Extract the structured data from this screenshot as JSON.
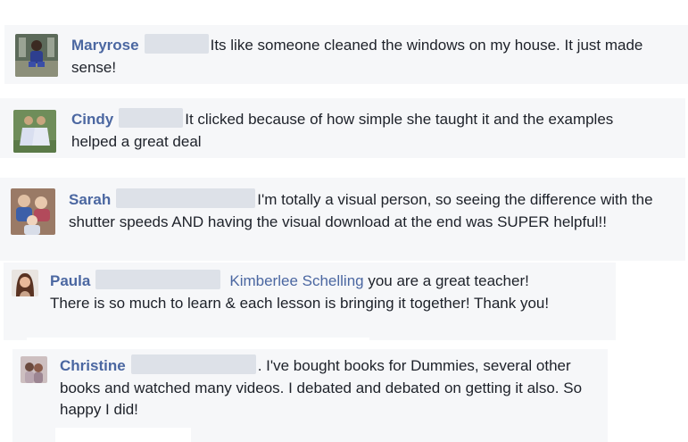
{
  "comments": [
    {
      "name": "Maryrose",
      "text": "Its like someone cleaned the windows on my house. It just made sense!",
      "avatar_icon": "person-avatar"
    },
    {
      "name": "Cindy",
      "text": "It clicked because of how simple she taught it and the examples helped a great deal",
      "avatar_icon": "two-girls-avatar"
    },
    {
      "name": "Sarah",
      "text": "I'm totally a visual person, so seeing the difference with the shutter speeds AND having the visual download at the end was SUPER helpful!!",
      "avatar_icon": "family-avatar"
    },
    {
      "name": "Paula",
      "mention": "Kimberlee Schelling",
      "text": "you are a great teacher! There is so much to learn & each lesson is bringing it together! Thank you!",
      "avatar_icon": "woman-avatar"
    },
    {
      "name": "Christine",
      "text": ". I've bought books for Dummies, several other books and watched many videos. I debated and debated on getting it also. So happy I did!",
      "avatar_icon": "children-avatar"
    }
  ],
  "colors": {
    "name": "#4b67a1",
    "text": "#1d2129",
    "card": "#f6f7f9",
    "redaction": "#dde1e8"
  }
}
